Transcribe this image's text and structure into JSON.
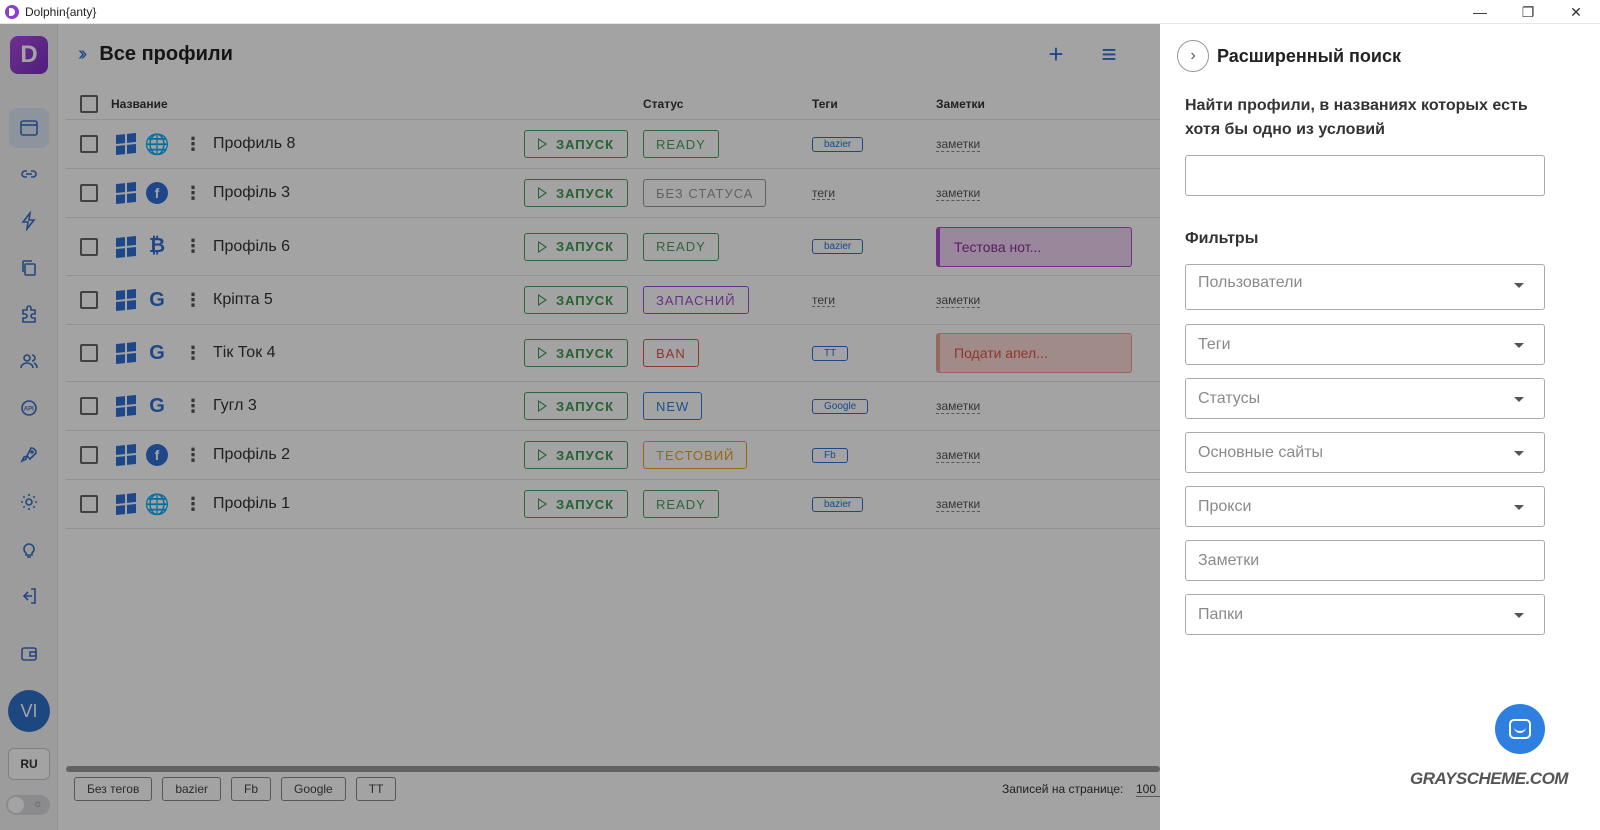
{
  "window": {
    "title": "Dolphin{anty}",
    "controls": {
      "minimize": "—",
      "restore": "❐",
      "close": "✕"
    }
  },
  "sidebar": {
    "logo": "D",
    "icons": [
      "browser-profiles-icon",
      "link-icon",
      "automation-icon",
      "copy-icon",
      "extensions-icon",
      "users-icon",
      "api-icon",
      "rocket-icon",
      "gear-icon",
      "lightbulb-icon",
      "logout-icon",
      "wallet-icon"
    ],
    "avatar": "VI",
    "language": "RU",
    "theme_symbol": "☼"
  },
  "header": {
    "chevrons": "››",
    "title": "Все профили",
    "add_symbol": "+",
    "filter_symbol": "≡"
  },
  "table": {
    "columns": {
      "name": "Название",
      "status": "Статус",
      "tags": "Теги",
      "notes": "Заметки"
    },
    "launch_label": "ЗАПУСК",
    "rows": [
      {
        "site": "globe",
        "site_glyph": "🌐",
        "name": "Профиль 8",
        "status": "READY",
        "status_color": "#4aa05a",
        "tag": "bazier",
        "tag_empty": false,
        "note": "заметки",
        "note_card": false,
        "height": 49
      },
      {
        "site": "facebook",
        "site_glyph": "f",
        "name": "Профіль 3",
        "status": "БЕЗ СТАТУСА",
        "status_color": "#9a9a9a",
        "tag": "теги",
        "tag_empty": true,
        "note": "заметки",
        "note_card": false,
        "height": 49
      },
      {
        "site": "bitcoin",
        "site_glyph": "₿",
        "name": "Профіль 6",
        "status": "READY",
        "status_color": "#4aa05a",
        "tag": "bazier",
        "tag_empty": false,
        "note": "Тестова нот...",
        "note_card": true,
        "note_bg": "#f0d4f2",
        "note_color": "#8a2f9a",
        "note_border": "#b04bd0",
        "height": 58
      },
      {
        "site": "google",
        "site_glyph": "G",
        "name": "Кріпта 5",
        "status": "ЗАПАСНИЙ",
        "status_color": "#a44bd0",
        "tag": "теги",
        "tag_empty": true,
        "note": "заметки",
        "note_card": false,
        "height": 49
      },
      {
        "site": "google",
        "site_glyph": "G",
        "name": "Тік Ток 4",
        "status": "BAN",
        "status_color": "#e05545",
        "tag": "TT",
        "tag_empty": false,
        "note": "Подати апел...",
        "note_card": true,
        "note_bg": "#fbd9d6",
        "note_color": "#e05545",
        "note_border": "#f0a09a",
        "height": 57
      },
      {
        "site": "google",
        "site_glyph": "G",
        "name": "Гугл 3",
        "status": "NEW",
        "status_color": "#2f7fe0",
        "tag": "Google",
        "tag_empty": false,
        "note": "заметки",
        "note_card": false,
        "height": 49
      },
      {
        "site": "facebook",
        "site_glyph": "f",
        "name": "Профіль 2",
        "status": "ТЕСТОВИЙ",
        "status_color": "#f0a020",
        "tag": "Fb",
        "tag_empty": false,
        "note": "заметки",
        "note_card": false,
        "height": 49
      },
      {
        "site": "globe",
        "site_glyph": "🌐",
        "name": "Профіль 1",
        "status": "READY",
        "status_color": "#4aa05a",
        "tag": "bazier",
        "tag_empty": false,
        "note": "заметки",
        "note_card": false,
        "height": 49
      }
    ]
  },
  "footer": {
    "tags": [
      "Без тегов",
      "bazier",
      "Fb",
      "Google",
      "TT"
    ],
    "per_page_label": "Записей на странице:",
    "per_page_value": "100"
  },
  "panel": {
    "back_symbol": "›",
    "title": "Расширенный поиск",
    "description": "Найти профили, в названиях которых есть хотя бы одно из условий",
    "search_value": "",
    "filters_title": "Фильтры",
    "filters": [
      {
        "name": "filter-users",
        "label": "Пользователи",
        "dropdown": true
      },
      {
        "name": "filter-tags",
        "label": "Теги",
        "dropdown": true
      },
      {
        "name": "filter-statuses",
        "label": "Статусы",
        "dropdown": true
      },
      {
        "name": "filter-main-sites",
        "label": "Основные сайты",
        "dropdown": true
      },
      {
        "name": "filter-proxy",
        "label": "Прокси",
        "dropdown": true
      },
      {
        "name": "filter-notes",
        "label": "Заметки",
        "dropdown": false
      },
      {
        "name": "filter-folders",
        "label": "Папки",
        "dropdown": true
      }
    ],
    "watermark": "GRAYSCHEME.COM"
  }
}
